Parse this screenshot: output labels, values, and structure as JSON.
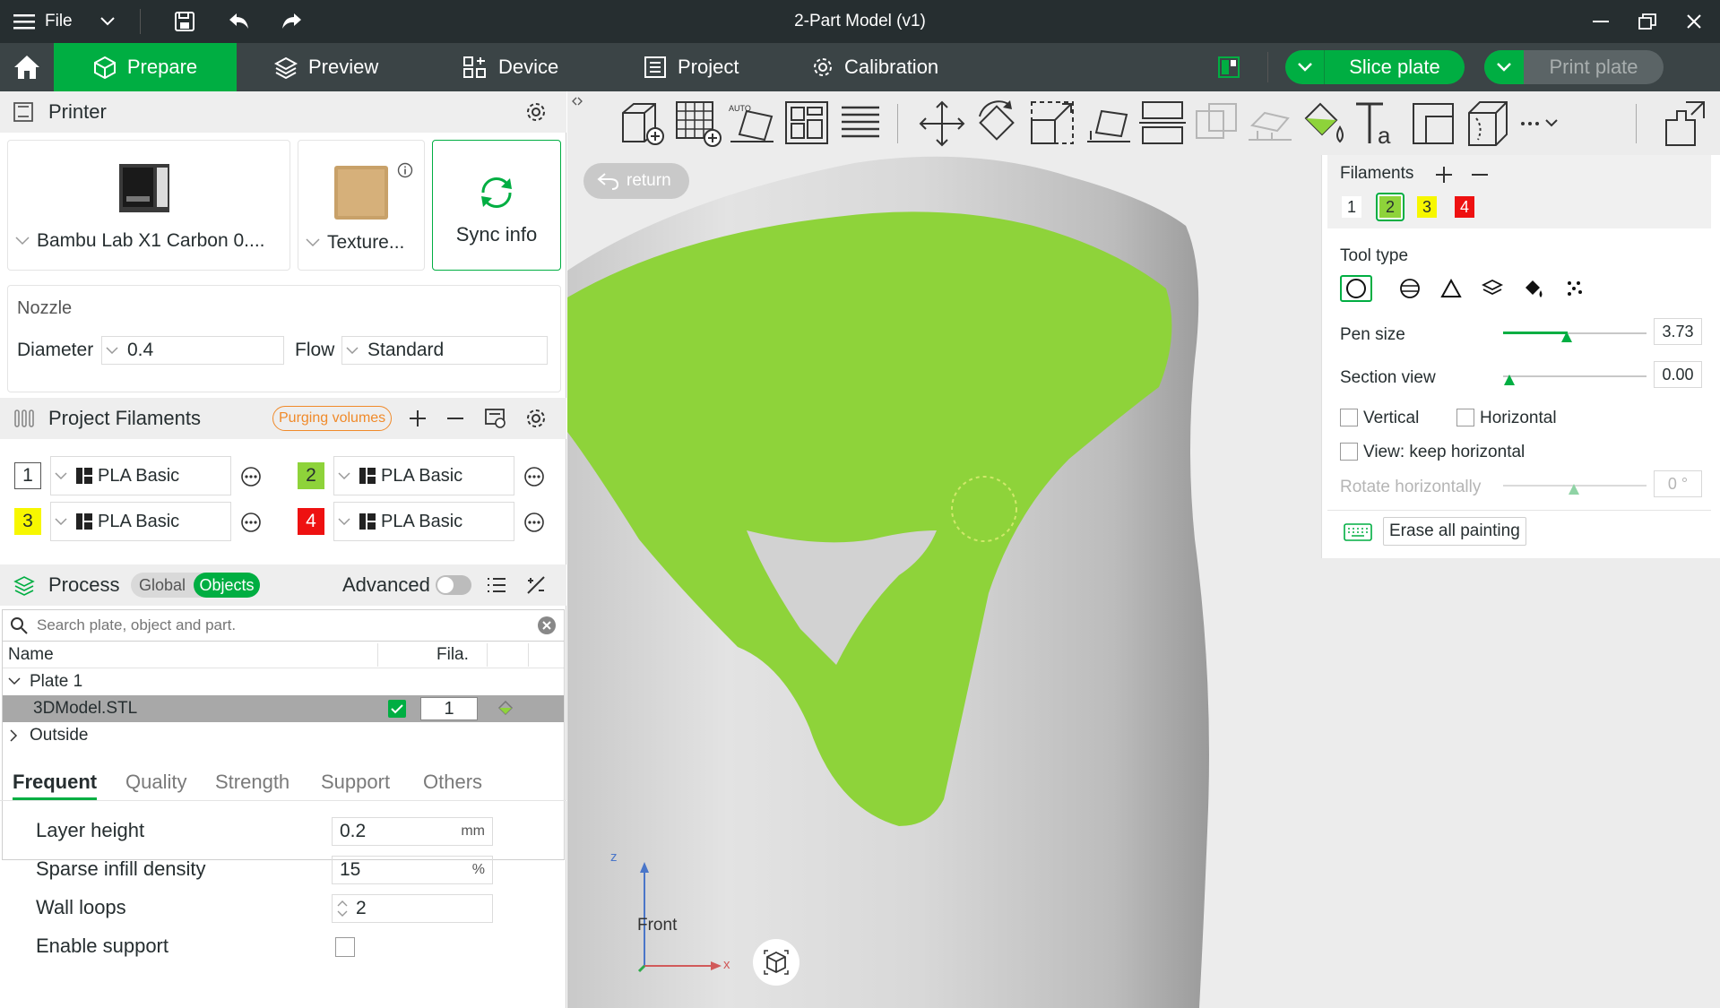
{
  "window": {
    "file_label": "File",
    "title": "2-Part Model (v1)"
  },
  "nav": {
    "tabs": [
      {
        "label": "Prepare"
      },
      {
        "label": "Preview"
      },
      {
        "label": "Device"
      },
      {
        "label": "Project"
      },
      {
        "label": "Calibration"
      }
    ],
    "slice_label": "Slice plate",
    "print_label": "Print plate"
  },
  "printer": {
    "header": "Printer",
    "name": "Bambu Lab X1 Carbon 0....",
    "plate": "Texture...",
    "sync_label": "Sync info",
    "nozzle_label": "Nozzle",
    "diameter_label": "Diameter",
    "diameter_value": "0.4",
    "flow_label": "Flow",
    "flow_value": "Standard"
  },
  "filaments": {
    "header": "Project Filaments",
    "purging_label": "Purging volumes",
    "items": [
      {
        "num": "1",
        "name": "PLA Basic",
        "color": "#ffffff"
      },
      {
        "num": "2",
        "name": "PLA Basic",
        "color": "#8ed33a"
      },
      {
        "num": "3",
        "name": "PLA Basic",
        "color": "#f7f700"
      },
      {
        "num": "4",
        "name": "PLA Basic",
        "color": "#ee1111"
      }
    ]
  },
  "process": {
    "header": "Process",
    "toggle_global": "Global",
    "toggle_objects": "Objects",
    "advanced_label": "Advanced",
    "search_placeholder": "Search plate, object and part.",
    "col_name": "Name",
    "col_fila": "Fila.",
    "plate_label": "Plate 1",
    "object_name": "3DModel.STL",
    "object_fila": "1",
    "outside_label": "Outside",
    "tabs": [
      "Frequent",
      "Quality",
      "Strength",
      "Support",
      "Others"
    ],
    "params": {
      "layer_height_label": "Layer height",
      "layer_height_value": "0.2",
      "layer_height_unit": "mm",
      "infill_label": "Sparse infill density",
      "infill_value": "15",
      "infill_unit": "%",
      "wall_label": "Wall loops",
      "wall_value": "2",
      "support_label": "Enable support"
    }
  },
  "viewport": {
    "return_label": "return",
    "front_label": "Front",
    "axis_z": "z",
    "axis_x": "x"
  },
  "paint": {
    "filaments_label": "Filaments",
    "filament_nums": [
      "1",
      "2",
      "3",
      "4"
    ],
    "tool_type_label": "Tool type",
    "pen_size_label": "Pen size",
    "pen_size_value": "3.73",
    "section_view_label": "Section view",
    "section_view_value": "0.00",
    "vertical_label": "Vertical",
    "horizontal_label": "Horizontal",
    "view_keep_label": "View: keep horizontal",
    "rotate_label": "Rotate horizontally",
    "rotate_value": "0 °",
    "erase_label": "Erase all painting"
  },
  "colors": {
    "accent": "#00ae42",
    "titlebar": "#262e30",
    "navbar": "#3b4446",
    "paint_green": "#8ed33a"
  }
}
